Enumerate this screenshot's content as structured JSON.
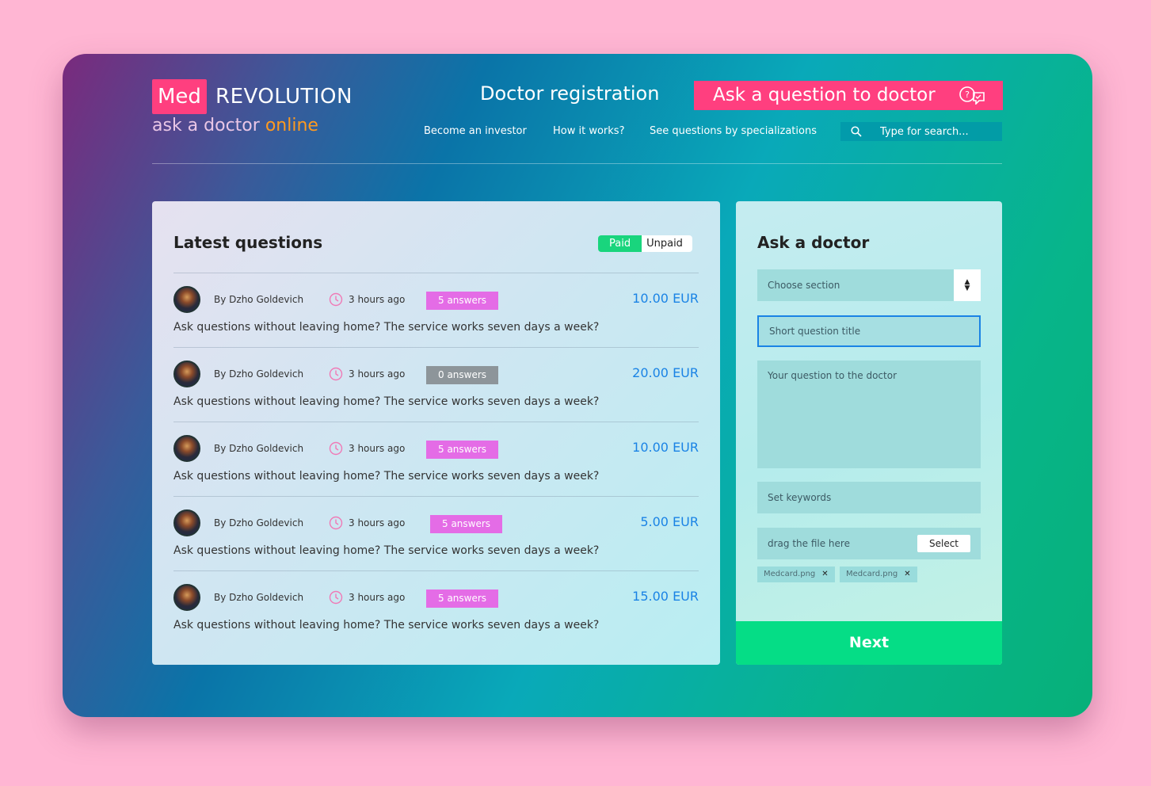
{
  "brand": {
    "med": "Med",
    "revolution": "REVOLUTION",
    "tagline_main": "ask a doctor",
    "tagline_accent": "online"
  },
  "header": {
    "doctor_registration": "Doctor registration",
    "ask_button": "Ask a question to doctor",
    "nav": [
      "Become an investor",
      "How it works?",
      "See questions by specializations"
    ],
    "search_placeholder": "Type for search..."
  },
  "questions": {
    "title": "Latest questions",
    "filter": {
      "paid": "Paid",
      "unpaid": "Unpaid",
      "active": "Paid"
    },
    "items": [
      {
        "author": "By Dzho Goldevich",
        "time": "3 hours ago",
        "answers": "5 answers",
        "price": "10.00 EUR",
        "text": "Ask questions without leaving home? The service works seven days a week?"
      },
      {
        "author": "By Dzho Goldevich",
        "time": "3 hours ago",
        "answers": "0 answers",
        "price": "20.00 EUR",
        "text": "Ask questions without leaving home? The service works seven days a week?"
      },
      {
        "author": "By Dzho Goldevich",
        "time": "3 hours ago",
        "answers": "5 answers",
        "price": "10.00 EUR",
        "text": "Ask questions without leaving home? The service works seven days a week?"
      },
      {
        "author": "By Dzho Goldevich",
        "time": "3 hours ago",
        "answers": "5 answers",
        "price": "5.00 EUR",
        "text": "Ask questions without leaving home? The service works seven days a week?"
      },
      {
        "author": "By Dzho Goldevich",
        "time": "3 hours ago",
        "answers": "5 answers",
        "price": "15.00 EUR",
        "text": "Ask questions without leaving home? The service works seven days a week?"
      }
    ]
  },
  "ask_form": {
    "title": "Ask a doctor",
    "section_select": "Choose section",
    "title_placeholder": "Short question title",
    "question_placeholder": "Your question to the doctor",
    "keywords_placeholder": "Set keywords",
    "file_drop": "drag the file here",
    "select_button": "Select",
    "attachments": [
      "Medcard.png",
      "Medcard.png"
    ],
    "next_button": "Next"
  },
  "colors": {
    "accent_pink": "#ff3f7f",
    "accent_orange": "#ff9a1f",
    "price_blue": "#1a83e5",
    "badge_magenta": "#e46ce6",
    "badge_grey": "#8d959a",
    "next_green": "#05dd86"
  },
  "icons": {
    "ask_button": "chat-bubbles-icon",
    "search": "search-icon",
    "time": "clock-icon",
    "select": "up-down-arrows-icon",
    "remove": "close-icon"
  }
}
